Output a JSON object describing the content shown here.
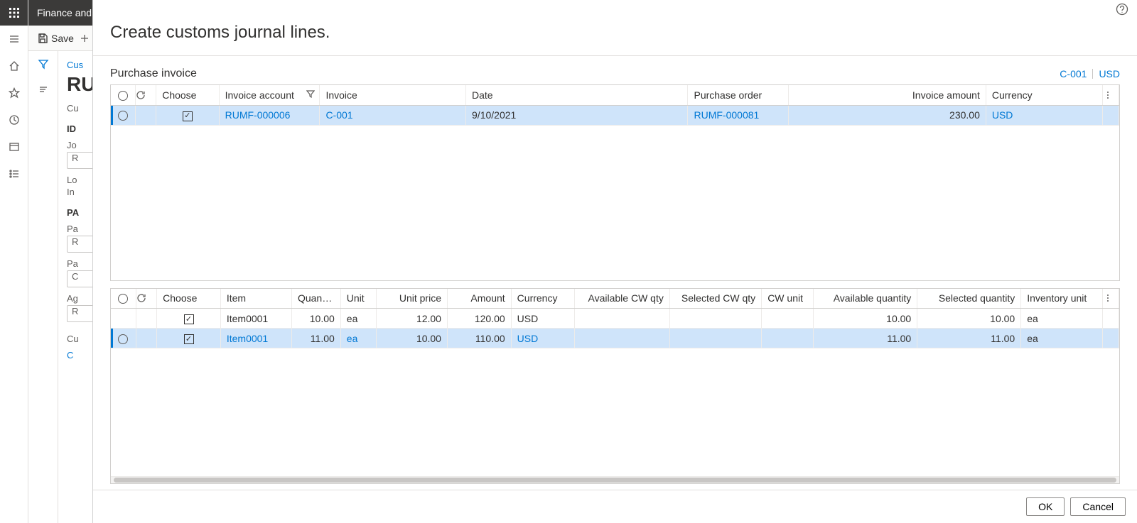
{
  "app": {
    "title": "Finance and"
  },
  "toolbar": {
    "save_label": "Save"
  },
  "bg": {
    "crumb": "Cus",
    "big": "RU",
    "tab1": "Cu",
    "id_hdr": "ID",
    "jo": "Jo",
    "r1": "R",
    "lo": "Lo",
    "in": "In",
    "pa_hdr": "PA",
    "pa": "Pa",
    "r2": "R",
    "pa2": "Pa",
    "c": "C",
    "ag": "Ag",
    "r3": "R",
    "tab2": "Cu",
    "link": "C"
  },
  "dialog": {
    "title": "Create customs journal lines.",
    "help_tooltip": "Help",
    "section_label": "Purchase invoice",
    "summary": {
      "invoice": "C-001",
      "currency": "USD"
    },
    "ok_label": "OK",
    "cancel_label": "Cancel"
  },
  "grid1": {
    "cols": {
      "choose": "Choose",
      "invoice_account": "Invoice account",
      "invoice": "Invoice",
      "date": "Date",
      "purchase_order": "Purchase order",
      "invoice_amount": "Invoice amount",
      "currency": "Currency"
    },
    "rows": [
      {
        "checked": true,
        "invoice_account": "RUMF-000006",
        "invoice": "C-001",
        "date": "9/10/2021",
        "purchase_order": "RUMF-000081",
        "invoice_amount": "230.00",
        "currency": "USD"
      }
    ]
  },
  "grid2": {
    "cols": {
      "choose": "Choose",
      "item": "Item",
      "quantity": "Quantity",
      "unit": "Unit",
      "unit_price": "Unit price",
      "amount": "Amount",
      "currency": "Currency",
      "avail_cw_qty": "Available CW qty",
      "sel_cw_qty": "Selected CW qty",
      "cw_unit": "CW unit",
      "avail_qty": "Available quantity",
      "sel_qty": "Selected quantity",
      "inv_unit": "Inventory unit"
    },
    "rows": [
      {
        "checked": true,
        "selected": false,
        "item": "Item0001",
        "quantity": "10.00",
        "unit": "ea",
        "unit_price": "12.00",
        "amount": "120.00",
        "currency": "USD",
        "avail_cw_qty": "",
        "sel_cw_qty": "",
        "cw_unit": "",
        "avail_qty": "10.00",
        "sel_qty": "10.00",
        "inv_unit": "ea"
      },
      {
        "checked": true,
        "selected": true,
        "item": "Item0001",
        "quantity": "11.00",
        "unit": "ea",
        "unit_price": "10.00",
        "amount": "110.00",
        "currency": "USD",
        "avail_cw_qty": "",
        "sel_cw_qty": "",
        "cw_unit": "",
        "avail_qty": "11.00",
        "sel_qty": "11.00",
        "inv_unit": "ea"
      }
    ]
  }
}
